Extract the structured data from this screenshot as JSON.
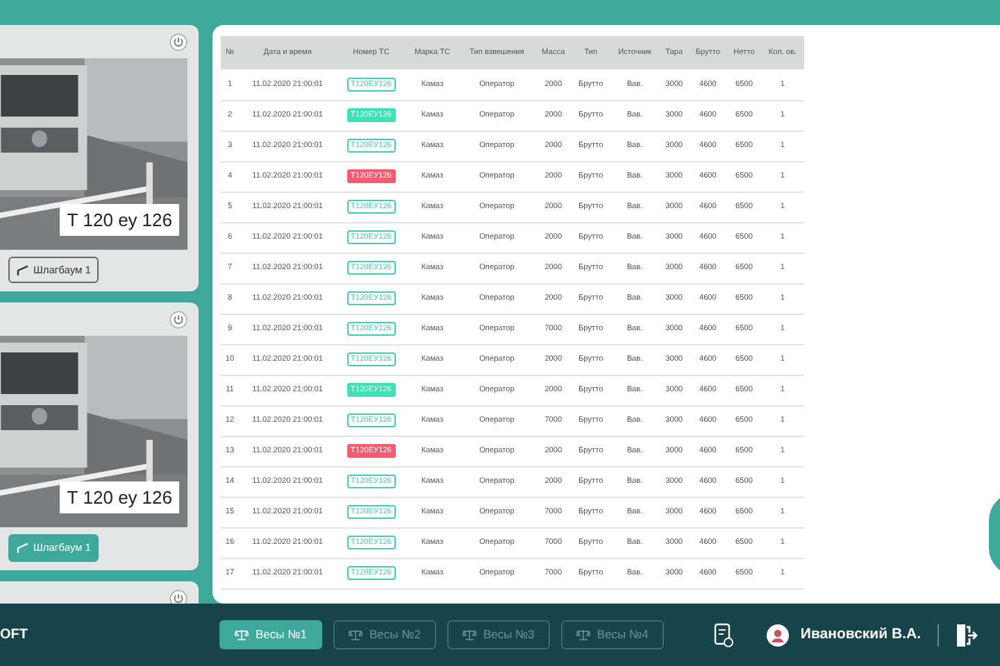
{
  "cameras": [
    {
      "plate": "Т 120 еу 126",
      "barrier": {
        "label": "Шлагбаум 1",
        "active": false
      },
      "power_on": false
    },
    {
      "plate": "Т 120 еу 126",
      "barrier": {
        "label": "Шлагбаум 1",
        "active": true
      },
      "power_on": false
    },
    {
      "power_on": false
    }
  ],
  "table": {
    "columns": [
      "№",
      "Дата и время",
      "Номер ТС",
      "Марка ТС",
      "Тип взвешения",
      "Масса",
      "Тип",
      "Источник",
      "Тара",
      "Брутто",
      "Нетто",
      "Кол. ов."
    ],
    "rows": [
      {
        "cells": [
          "1",
          "11.02.2020 21:00:01",
          "Т120ЕУ126",
          "Камаз",
          "Оператор",
          "2000",
          "Брутто",
          "Вав.",
          "3000",
          "4600",
          "6500",
          "1"
        ],
        "filled": false,
        "color": "#49c9b1"
      },
      {
        "cells": [
          "2",
          "11.02.2020 21:00:01",
          "Т120ЕУ126",
          "Камаз",
          "Оператор",
          "2000",
          "Брутто",
          "Вав.",
          "3000",
          "4600",
          "6500",
          "1"
        ],
        "filled": true,
        "color": "#3ee0b4"
      },
      {
        "cells": [
          "3",
          "11.02.2020 21:00:01",
          "Т120ЕУ126",
          "Камаз",
          "Оператор",
          "2000",
          "Брутто",
          "Вав.",
          "3000",
          "4600",
          "6500",
          "1"
        ],
        "filled": false,
        "color": "#49c9b1"
      },
      {
        "cells": [
          "4",
          "11.02.2020 21:00:01",
          "Т120ЕУ126",
          "Камаз",
          "Оператор",
          "2000",
          "Брутто",
          "Вав.",
          "3000",
          "4600",
          "6500",
          "1"
        ],
        "filled": true,
        "color": "#f45c72"
      },
      {
        "cells": [
          "5",
          "11.02.2020 21:00:01",
          "Т120ЕУ126",
          "Камаз",
          "Оператор",
          "2000",
          "Брутто",
          "Вав.",
          "3000",
          "4600",
          "6500",
          "1"
        ],
        "filled": false,
        "color": "#49c9b1"
      },
      {
        "cells": [
          "6",
          "11.02.2020 21:00:01",
          "Т120ЕУ126",
          "Камаз",
          "Оператор",
          "2000",
          "Брутто",
          "Вав.",
          "3000",
          "4600",
          "6500",
          "1"
        ],
        "filled": false,
        "color": "#49c9b1"
      },
      {
        "cells": [
          "7",
          "11.02.2020 21:00:01",
          "Т120ЕУ126",
          "Камаз",
          "Оператор",
          "2000",
          "Брутто",
          "Вав.",
          "3000",
          "4600",
          "6500",
          "1"
        ],
        "filled": false,
        "color": "#49c9b1"
      },
      {
        "cells": [
          "8",
          "11.02.2020 21:00:01",
          "Т120ЕУ126",
          "Камаз",
          "Оператор",
          "2000",
          "Брутто",
          "Вав.",
          "3000",
          "4600",
          "6500",
          "1"
        ],
        "filled": false,
        "color": "#49c9b1"
      },
      {
        "cells": [
          "9",
          "11.02.2020 21:00:01",
          "Т120ЕУ126",
          "Камаз",
          "Оператор",
          "7000",
          "Брутто",
          "Вав.",
          "3000",
          "4600",
          "6500",
          "1"
        ],
        "filled": false,
        "color": "#49c9b1"
      },
      {
        "cells": [
          "10",
          "11.02.2020 21:00:01",
          "Т120ЕУ126",
          "Камаз",
          "Оператор",
          "2000",
          "Брутто",
          "Вав.",
          "3000",
          "4600",
          "6500",
          "1"
        ],
        "filled": false,
        "color": "#49c9b1"
      },
      {
        "cells": [
          "11",
          "11.02.2020 21:00:01",
          "Т120ЕУ126",
          "Камаз",
          "Оператор",
          "2000",
          "Брутто",
          "Вав.",
          "3000",
          "4600",
          "6500",
          "1"
        ],
        "filled": true,
        "color": "#3ee0b4"
      },
      {
        "cells": [
          "12",
          "11.02.2020 21:00:01",
          "Т120ЕУ126",
          "Камаз",
          "Оператор",
          "7000",
          "Брутто",
          "Вав.",
          "3000",
          "4600",
          "6500",
          "1"
        ],
        "filled": false,
        "color": "#49c9b1"
      },
      {
        "cells": [
          "13",
          "11.02.2020 21:00:01",
          "Т120ЕУ126",
          "Камаз",
          "Оператор",
          "2000",
          "Брутто",
          "Вав.",
          "3000",
          "4600",
          "6500",
          "1"
        ],
        "filled": true,
        "color": "#f45c72"
      },
      {
        "cells": [
          "14",
          "11.02.2020 21:00:01",
          "Т120ЕУ126",
          "Камаз",
          "Оператор",
          "2000",
          "Брутто",
          "Вав.",
          "3000",
          "4600",
          "6500",
          "1"
        ],
        "filled": false,
        "color": "#49c9b1"
      },
      {
        "cells": [
          "15",
          "11.02.2020 21:00:01",
          "Т120ЕУ126",
          "Камаз",
          "Оператор",
          "7000",
          "Брутто",
          "Вав.",
          "3000",
          "4600",
          "6500",
          "1"
        ],
        "filled": false,
        "color": "#49c9b1"
      },
      {
        "cells": [
          "16",
          "11.02.2020 21:00:01",
          "Т120ЕУ126",
          "Камаз",
          "Оператор",
          "7000",
          "Брутто",
          "Вав.",
          "3000",
          "4600",
          "6500",
          "1"
        ],
        "filled": false,
        "color": "#49c9b1"
      },
      {
        "cells": [
          "17",
          "11.02.2020 21:00:01",
          "Т120ЕУ126",
          "Камаз",
          "Оператор",
          "7000",
          "Брутто",
          "Вав.",
          "3000",
          "4600",
          "6500",
          "1"
        ],
        "filled": false,
        "color": "#49c9b1"
      }
    ]
  },
  "footer": {
    "logo": "OFT",
    "scales": [
      {
        "label": "Весы №1",
        "selected": true
      },
      {
        "label": "Весы №2",
        "selected": false
      },
      {
        "label": "Весы №3",
        "selected": false
      },
      {
        "label": "Весы №4",
        "selected": false
      }
    ],
    "user": "Ивановский В.А."
  }
}
